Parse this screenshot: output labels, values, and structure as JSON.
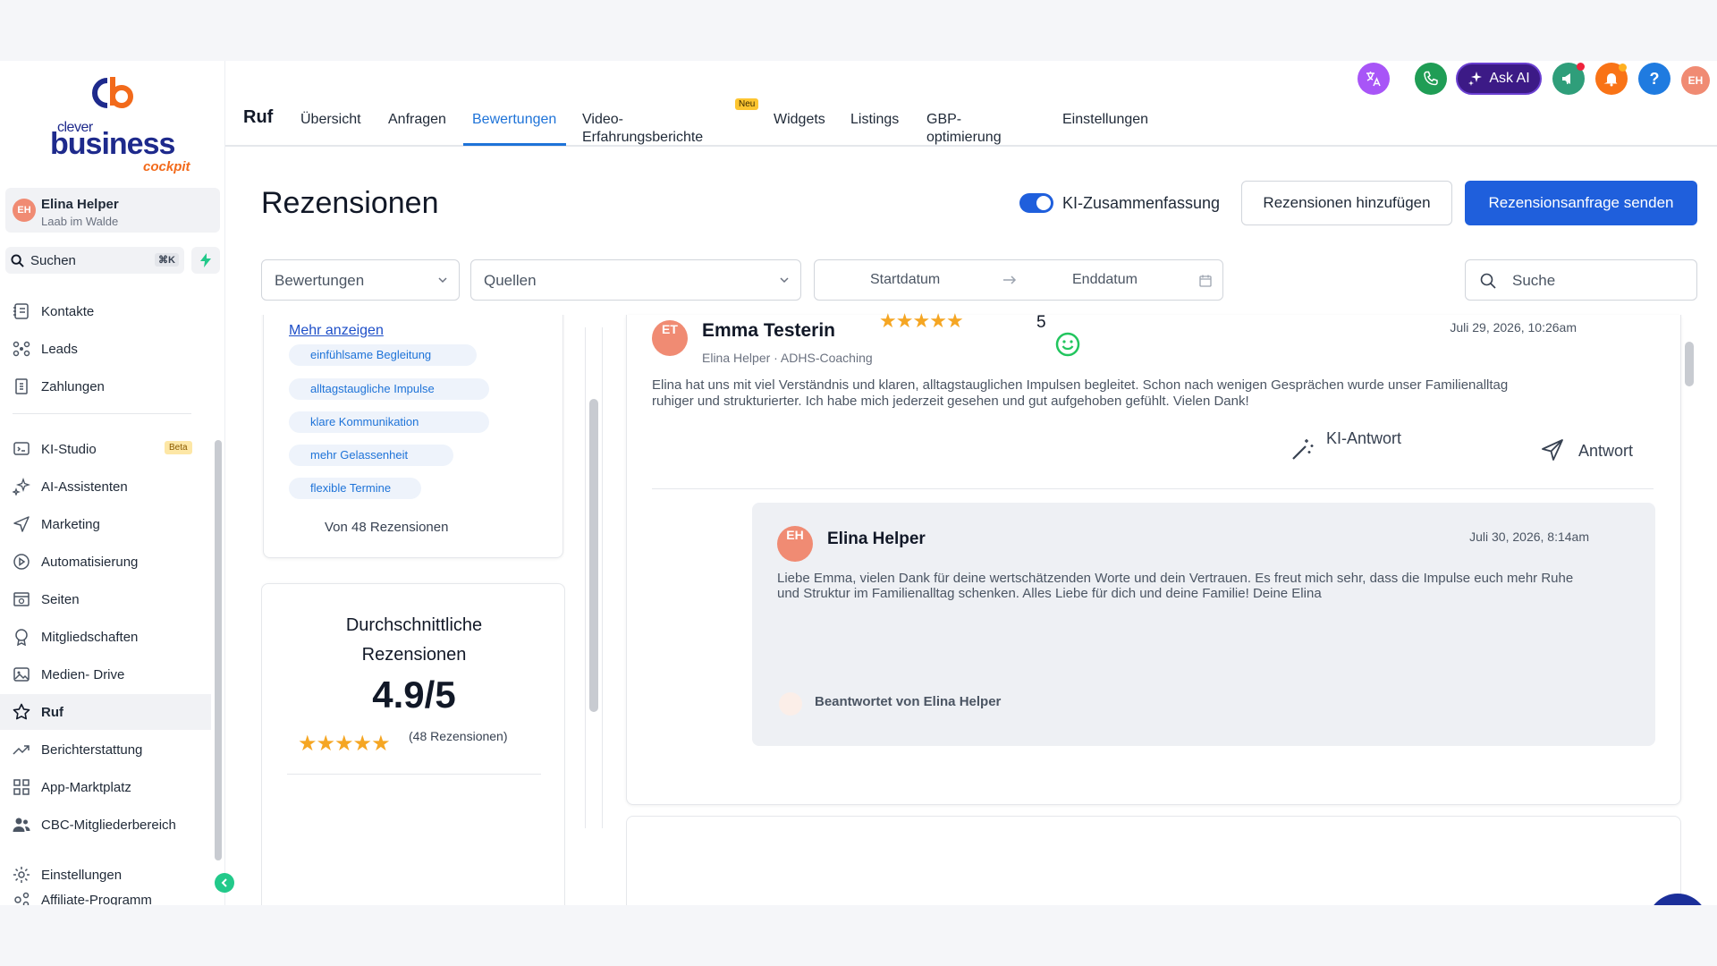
{
  "brand": {
    "logo_clever": "clever",
    "logo_business": "business",
    "logo_cockpit": "cockpit",
    "colors": {
      "navy": "#1e2a8c",
      "orange": "#f26a1b",
      "primary": "#1f5fdc",
      "star": "#f5a623"
    }
  },
  "user": {
    "initials": "EH",
    "name": "Elina Helper",
    "location": "Laab im Walde"
  },
  "sidebar": {
    "search_label": "Suchen",
    "search_shortcut": "⌘K",
    "items": [
      {
        "label": "Kontakte",
        "icon": "contacts-icon"
      },
      {
        "label": "Leads",
        "icon": "leads-icon"
      },
      {
        "label": "Zahlungen",
        "icon": "payments-icon"
      },
      {
        "label": "KI-Studio",
        "icon": "ai-studio-icon",
        "badge": "Beta"
      },
      {
        "label": "AI-Assistenten",
        "icon": "sparkles-icon"
      },
      {
        "label": "Marketing",
        "icon": "send-icon"
      },
      {
        "label": "Automatisierung",
        "icon": "play-circle-icon"
      },
      {
        "label": "Seiten",
        "icon": "pages-icon"
      },
      {
        "label": "Mitgliedschaften",
        "icon": "badge-icon"
      },
      {
        "label": "Medien- Drive",
        "icon": "image-icon"
      },
      {
        "label": "Ruf",
        "icon": "star-icon",
        "active": true
      },
      {
        "label": "Berichterstattung",
        "icon": "trend-icon"
      },
      {
        "label": "App-Marktplatz",
        "icon": "grid-icon"
      },
      {
        "label": "CBC-Mitgliederbereich",
        "icon": "users-icon"
      },
      {
        "label": "Einstellungen",
        "icon": "gear-icon"
      },
      {
        "label": "Affiliate-Programm",
        "icon": "affiliate-icon"
      }
    ]
  },
  "topbar": {
    "section_title": "Ruf",
    "ask_ai_label": "Ask AI",
    "avatar_initials": "EH",
    "tabs": [
      {
        "label": "Übersicht"
      },
      {
        "label": "Anfragen"
      },
      {
        "label": "Bewertungen",
        "active": true
      },
      {
        "label": "Video-Erfahrungsberichte",
        "badge": "Neu"
      },
      {
        "label": "Widgets"
      },
      {
        "label": "Listings"
      },
      {
        "label": "GBP-optimierung"
      },
      {
        "label": "Einstellungen"
      }
    ]
  },
  "main": {
    "title": "Rezensionen",
    "ai_summary_label": "KI-Zusammenfassung",
    "ai_summary_on": true,
    "add_reviews_label": "Rezensionen hinzufügen",
    "send_request_label": "Rezensionsanfrage senden",
    "filters": {
      "ratings_label": "Bewertungen",
      "sources_label": "Quellen",
      "start_date": "Startdatum",
      "end_date": "Enddatum",
      "search_placeholder": "Suche"
    }
  },
  "summary": {
    "show_more": "Mehr anzeigen",
    "tags": [
      "einfühlsame Begleitung",
      "alltagstaugliche Impulse",
      "klare Kommunikation",
      "mehr Gelassenheit",
      "flexible Termine"
    ],
    "count_text": "Von 48 Rezensionen",
    "avg_title": "Durchschnittliche Rezensionen",
    "avg_value": "4.9/5",
    "avg_stars": 5,
    "avg_count": "(48 Rezensionen)"
  },
  "review": {
    "initials": "ET",
    "author": "Emma Testerin",
    "meta": "Elina Helper · ADHS-Coaching",
    "stars": 5,
    "rating": "5",
    "date": "Juli 29, 2026, 10:26am",
    "text": "Elina hat uns mit viel Verständnis und klaren, alltagstauglichen Impulsen begleitet. Schon nach wenigen Gesprächen wurde unser Familienalltag ruhiger und strukturierter. Ich habe mich jederzeit gesehen und gut aufgehoben gefühlt. Vielen Dank!",
    "ai_reply_label": "KI-Antwort",
    "reply_label": "Antwort",
    "reply": {
      "initials": "EH",
      "author": "Elina Helper",
      "date": "Juli 30, 2026, 8:14am",
      "text": "Liebe Emma, vielen Dank für deine wertschätzenden Worte und dein Vertrauen. Es freut mich sehr, dass die Impulse euch mehr Ruhe und Struktur im Familienalltag schenken. Alles Liebe für dich und deine Familie! Deine Elina",
      "answered_by": "Beantwortet von Elina Helper"
    }
  }
}
